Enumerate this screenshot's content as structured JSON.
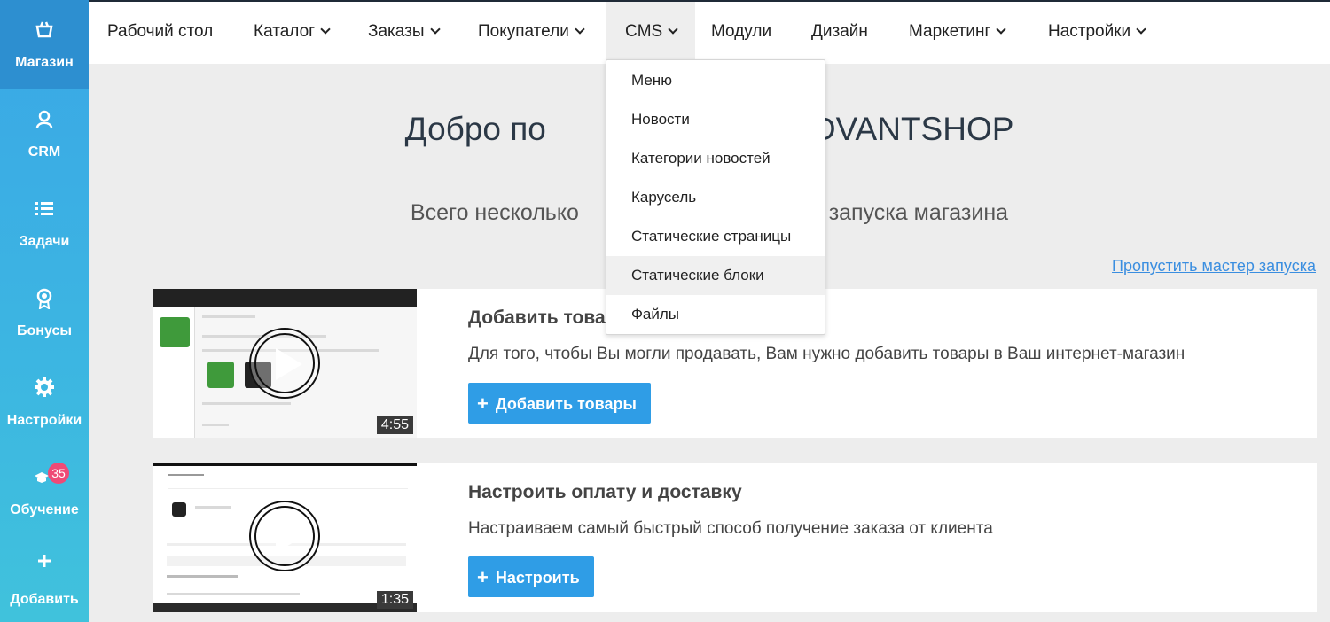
{
  "sidebar": {
    "items": [
      {
        "label": "Магазин",
        "icon": "basket-icon"
      },
      {
        "label": "CRM",
        "icon": "user-icon"
      },
      {
        "label": "Задачи",
        "icon": "list-icon"
      },
      {
        "label": "Бонусы",
        "icon": "medal-icon"
      },
      {
        "label": "Настройки",
        "icon": "gear-icon"
      },
      {
        "label": "Обучение",
        "icon": "graduation-cap-icon",
        "badge": "35"
      },
      {
        "label": "Добавить",
        "icon": "plus-icon"
      }
    ],
    "active": "Магазин"
  },
  "nav": {
    "items": [
      {
        "label": "Рабочий стол"
      },
      {
        "label": "Каталог"
      },
      {
        "label": "Заказы"
      },
      {
        "label": "Покупатели"
      },
      {
        "label": "CMS"
      },
      {
        "label": "Модули"
      },
      {
        "label": "Дизайн"
      },
      {
        "label": "Маркетинг"
      },
      {
        "label": "Настройки"
      }
    ],
    "open": "CMS"
  },
  "cms_menu": {
    "items": [
      "Меню",
      "Новости",
      "Категории новостей",
      "Карусель",
      "Статические страницы",
      "Статические блоки",
      "Файлы"
    ],
    "hovered": "Статические блоки"
  },
  "main": {
    "welcome_left": "Добро по",
    "welcome_right": "DVANTSHOP",
    "subtitle_left": "Всего несколько",
    "subtitle_right": "от запуска магазина",
    "skip_link": "Пропустить мастер запуска"
  },
  "steps": [
    {
      "title": "Добавить товар",
      "description": "Для того, чтобы Вы могли продавать, Вам нужно добавить товары в Ваш интернет-магазин",
      "button": "Добавить товары",
      "duration": "4:55"
    },
    {
      "title": "Настроить оплату и доставку",
      "description": "Настраиваем самый быстрый способ получение заказа от клиента",
      "button": "Настроить",
      "duration": "1:35"
    }
  ],
  "colors": {
    "sidebar": "#3aa7e6",
    "sidebar_active": "#2d8fd0",
    "button": "#2f9de6",
    "link": "#3a8ee0",
    "badge": "#ef4a76"
  }
}
